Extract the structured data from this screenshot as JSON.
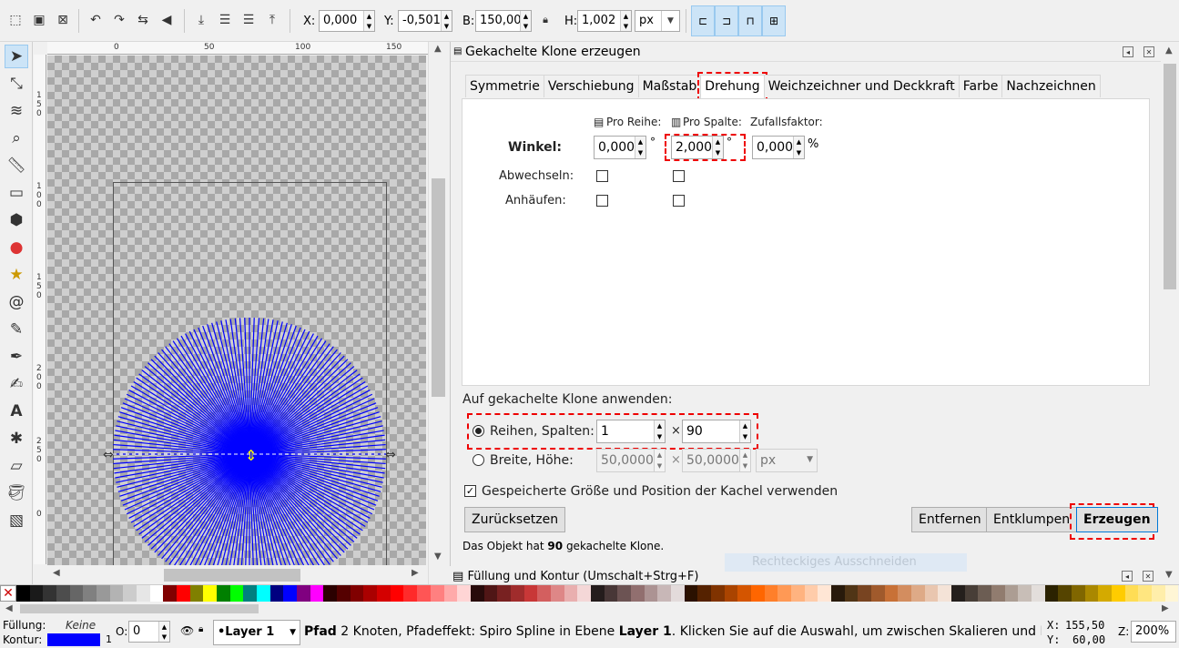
{
  "toolbar": {
    "x_label": "X:",
    "x_value": "0,000",
    "y_label": "Y:",
    "y_value": "-0,501",
    "w_label": "B:",
    "w_value": "150,000",
    "h_label": "H:",
    "h_value": "1,002",
    "unit": "px"
  },
  "ruler": {
    "top_ticks": [
      "0",
      "50",
      "100",
      "150"
    ],
    "left_ticks": [
      "1",
      "5",
      "0",
      "1",
      "0",
      "0",
      "1",
      "5",
      "0",
      "2",
      "0",
      "0",
      "2",
      "5",
      "0",
      "0"
    ]
  },
  "dialog": {
    "title": "Gekachelte Klone erzeugen",
    "tabs": [
      "Symmetrie",
      "Verschiebung",
      "Maßstab",
      "Drehung",
      "Weichzeichner und Deckkraft",
      "Farbe",
      "Nachzeichnen"
    ],
    "active_tab": "Drehung",
    "headers": {
      "per_row": "Pro Reihe:",
      "per_column": "Pro Spalte:",
      "random": "Zufallsfaktor:"
    },
    "angle_label": "Winkel:",
    "angle_row": "0,000",
    "angle_column": "2,000",
    "angle_random": "0,000",
    "deg_symbol": "°",
    "percent_symbol": "%",
    "alternate_label": "Abwechseln:",
    "cumulate_label": "Anhäufen:",
    "apply_title": "Auf gekachelte Klone anwenden:",
    "rows_cols_label": "Reihen, Spalten:",
    "rows": "1",
    "cols": "90",
    "times": "×",
    "width_height_label": "Breite, Höhe:",
    "width": "50,0000",
    "height": "50,0000",
    "wh_unit": "px",
    "use_saved_label": "Gespeicherte Größe und Position der Kachel verwenden",
    "reset_button": "Zurücksetzen",
    "remove_button": "Entfernen",
    "unclump_button": "Entklumpen",
    "create_button": "Erzeugen",
    "status_prefix": "Das Objekt hat",
    "status_count": "90",
    "status_suffix": "gekachelte Klone.",
    "ghost_tooltip": "Rechteckiges Ausschneiden",
    "next_panel": "Füllung und Kontur (Umschalt+Strg+F)"
  },
  "statusbar": {
    "fill_label": "Füllung:",
    "fill_value": "Keine",
    "stroke_label": "Kontur:",
    "stroke_width": "1",
    "opacity_label": "O:",
    "opacity_value": "0",
    "layer": "•Layer 1",
    "message_bold1": "Pfad",
    "message_part1": " 2 Knoten, Pfadeffekt: Spiro Spline in Ebene ",
    "message_bold2": "Layer 1",
    "message_part2": ". Klicken Sie auf die Auswahl, um zwischen Skalieren und Rotiere…",
    "x_label": "X:",
    "x_value": "155,50",
    "y_label": "Y:",
    "y_value": "60,00",
    "zoom_label": "Z:",
    "zoom_value": "200%"
  },
  "colors": {
    "accent": "#0078d7",
    "highlight": "#ee0000",
    "clone_blue": "#0000ff",
    "stroke_swatch": "#0000ff"
  },
  "palette": [
    "#000000",
    "#1a1a1a",
    "#333333",
    "#4d4d4d",
    "#666666",
    "#808080",
    "#999999",
    "#b3b3b3",
    "#cccccc",
    "#e6e6e6",
    "#ffffff",
    "#800000",
    "#ff0000",
    "#808000",
    "#ffff00",
    "#008000",
    "#00ff00",
    "#008080",
    "#00ffff",
    "#000080",
    "#0000ff",
    "#800080",
    "#ff00ff",
    "#2b0000",
    "#550000",
    "#800000",
    "#aa0000",
    "#d40000",
    "#ff0000",
    "#ff2a2a",
    "#ff5555",
    "#ff8080",
    "#ffaaaa",
    "#ffd5d5",
    "#280b0b",
    "#501616",
    "#782121",
    "#a02c2c",
    "#c83737",
    "#d35f5f",
    "#de8787",
    "#e9afaf",
    "#f4d7d7",
    "#241c1c",
    "#483737",
    "#6c5353",
    "#916f6f",
    "#ac9393",
    "#c8b7b7",
    "#e3dbdb",
    "#2b1100",
    "#552200",
    "#803300",
    "#aa4400",
    "#d45500",
    "#ff6600",
    "#ff7f2a",
    "#ff9955",
    "#ffb380",
    "#ffccaa",
    "#ffe6d5",
    "#281a0b",
    "#503516",
    "#784421",
    "#a05a2c",
    "#c87137",
    "#d38d5f",
    "#deaa87",
    "#e9c6af",
    "#f4e3d7",
    "#241f1c",
    "#483e37",
    "#6c5d53",
    "#917c6f",
    "#ac9d93",
    "#c8beb7",
    "#e3dedb",
    "#2b2200",
    "#554400",
    "#806600",
    "#aa8800",
    "#d4aa00",
    "#ffcc00",
    "#ffdd55",
    "#ffe680",
    "#ffeeaa",
    "#fff6d5"
  ]
}
